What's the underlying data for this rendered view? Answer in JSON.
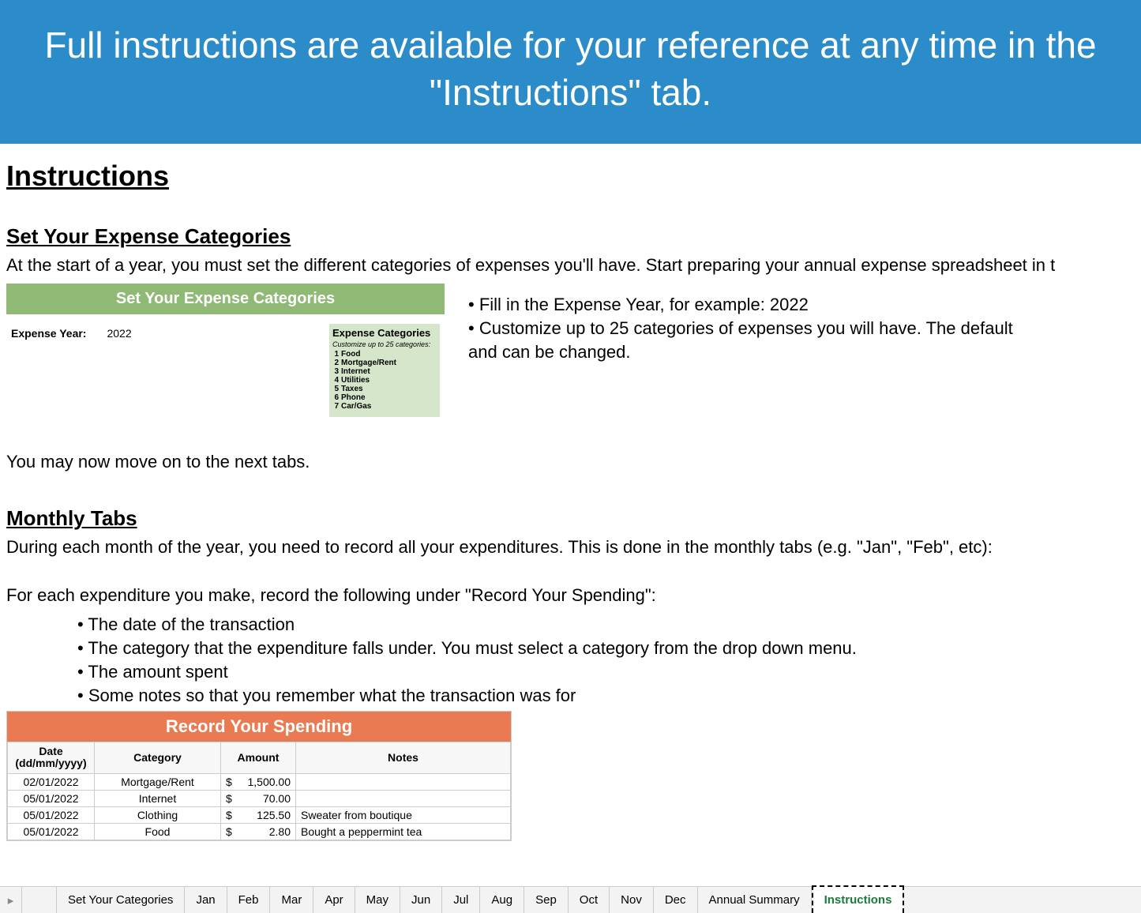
{
  "banner": "Full instructions are available for your reference at any time in the \"Instructions\" tab.",
  "page_title": "Instructions",
  "section1": {
    "heading": "Set Your Expense Categories",
    "intro": "At the start of a year, you must set the different categories of expenses you'll have. Start preparing your annual expense spreadsheet in t",
    "box_header": "Set Your Expense Categories",
    "exp_year_label": "Expense Year:",
    "exp_year_value": "2022",
    "cat_title": "Expense Categories",
    "cat_sub": "Customize up to 25 categories:",
    "categories": [
      "Food",
      "Mortgage/Rent",
      "Internet",
      "Utilities",
      "Taxes",
      "Phone",
      "Car/Gas"
    ],
    "right_bullets": [
      "• Fill in the Expense Year, for example:  2022",
      "• Customize up to 25 categories of expenses you will have. The default",
      "and can be changed."
    ],
    "outro": "You may now move on to the next tabs."
  },
  "section2": {
    "heading": "Monthly Tabs",
    "intro": "During each month of the year, you need to record all your expenditures. This is done in the monthly tabs (e.g. \"Jan\", \"Feb\", etc):",
    "lead": "For each expenditure you make, record the following under \"Record Your Spending\":",
    "bullets": [
      "The date of the transaction",
      "The category that the expenditure falls under. You must select a category from the drop down menu.",
      "The amount spent",
      "Some notes so that you remember what the transaction was for"
    ],
    "spending_header": "Record Your Spending",
    "cols": {
      "date": "Date\n(dd/mm/yyyy)",
      "category": "Category",
      "amount": "Amount",
      "notes": "Notes"
    },
    "rows": [
      {
        "date": "02/01/2022",
        "category": "Mortgage/Rent",
        "amount": "1,500.00",
        "notes": ""
      },
      {
        "date": "05/01/2022",
        "category": "Internet",
        "amount": "70.00",
        "notes": ""
      },
      {
        "date": "05/01/2022",
        "category": "Clothing",
        "amount": "125.50",
        "notes": "Sweater from boutique"
      },
      {
        "date": "05/01/2022",
        "category": "Food",
        "amount": "2.80",
        "notes": "Bought a peppermint tea"
      }
    ]
  },
  "tabs": [
    "Set Your Categories",
    "Jan",
    "Feb",
    "Mar",
    "Apr",
    "May",
    "Jun",
    "Jul",
    "Aug",
    "Sep",
    "Oct",
    "Nov",
    "Dec",
    "Annual Summary",
    "Instructions"
  ],
  "active_tab": "Instructions"
}
